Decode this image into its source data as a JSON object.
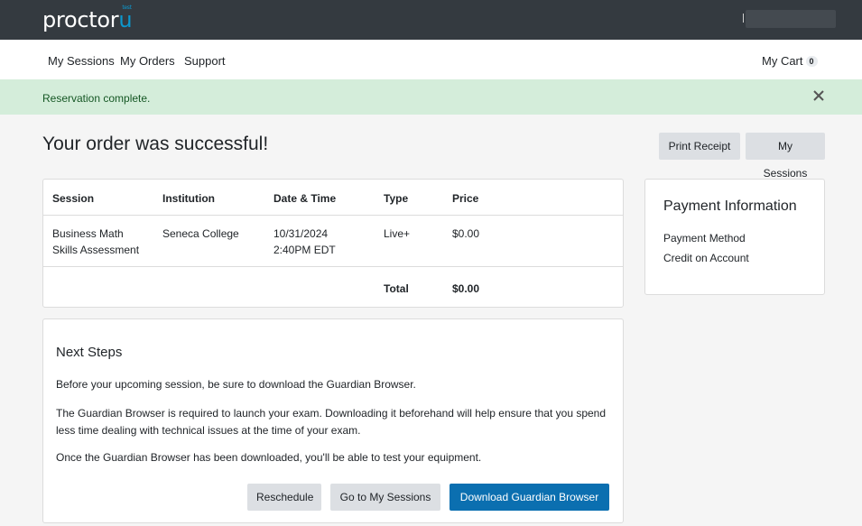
{
  "brand": {
    "name_main": "proctor",
    "name_u": "u",
    "name_tiny": "test"
  },
  "nav": {
    "links": [
      "My Sessions",
      "My Orders",
      "Support"
    ],
    "cart_label": "My Cart",
    "cart_count": "0"
  },
  "alert": {
    "message": "Reservation complete."
  },
  "header": {
    "title": "Your order was successful!",
    "print_receipt": "Print Receipt",
    "my_sessions": "My Sessions"
  },
  "order": {
    "columns": [
      "Session",
      "Institution",
      "Date & Time",
      "Type",
      "Price"
    ],
    "row": {
      "session_line1": "Business Math",
      "session_line2": "Skills Assessment",
      "institution": "Seneca College",
      "date": "10/31/2024",
      "time": "2:40PM EDT",
      "type": "Live+",
      "price": "$0.00"
    },
    "total_label": "Total",
    "total_value": "$0.00"
  },
  "payment": {
    "title": "Payment Information",
    "method_label": "Payment Method",
    "method_value": "Credit on Account"
  },
  "next_steps": {
    "title": "Next Steps",
    "p1": "Before your upcoming session, be sure to download the Guardian Browser.",
    "p2": "The Guardian Browser is required to launch your exam. Downloading it beforehand will help ensure that you spend less time dealing with technical issues at the time of your exam.",
    "p3": "Once the Guardian Browser has been downloaded, you'll be able to test your equipment.",
    "reschedule": "Reschedule",
    "go_to_sessions": "Go to My Sessions",
    "download": "Download Guardian Browser"
  },
  "colors": {
    "topbar": "#343a40",
    "alert_bg": "#d4edda",
    "alert_text": "#155724",
    "primary": "#0b6fb0",
    "brand_accent": "#0c98ce"
  },
  "icons": {
    "close": "close-icon"
  }
}
